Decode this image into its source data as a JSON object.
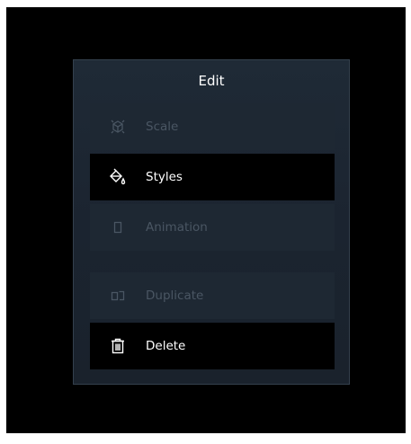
{
  "menu": {
    "title": "Edit",
    "items": [
      {
        "label": "Scale",
        "icon": "scale-icon",
        "state": "disabled"
      },
      {
        "label": "Styles",
        "icon": "paint-bucket-icon",
        "state": "enabled"
      },
      {
        "label": "Animation",
        "icon": "animation-icon",
        "state": "disabled"
      },
      {
        "label": "Duplicate",
        "icon": "duplicate-icon",
        "state": "disabled"
      },
      {
        "label": "Delete",
        "icon": "trash-icon",
        "state": "enabled"
      }
    ]
  },
  "colors": {
    "background": "#000000",
    "panel": "#1c2531",
    "panel_border": "#34404d",
    "disabled_row": "#1e2833",
    "disabled_text": "#4a5663",
    "active_row": "#000000",
    "active_text": "#ffffff"
  }
}
